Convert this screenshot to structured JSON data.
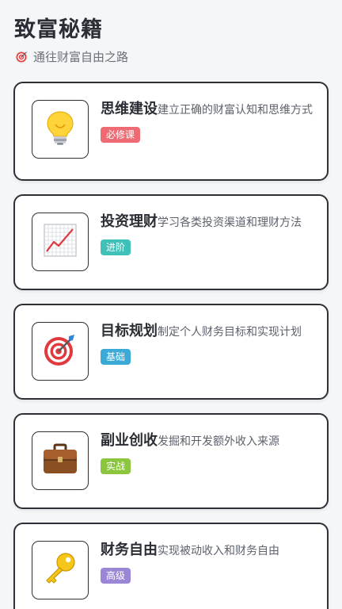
{
  "header": {
    "title": "致富秘籍",
    "subtitle": "通往财富自由之路",
    "subtitle_icon": "target-icon"
  },
  "cards": [
    {
      "title": "思维建设",
      "desc": "建立正确的财富认知和思维方式",
      "tag": "必修课",
      "tag_color": "#ef6b73",
      "icon": "lightbulb-icon"
    },
    {
      "title": "投资理财",
      "desc": "学习各类投资渠道和理财方法",
      "tag": "进阶",
      "tag_color": "#3fc1b8",
      "icon": "chart-increasing-icon"
    },
    {
      "title": "目标规划",
      "desc": "制定个人财务目标和实现计划",
      "tag": "基础",
      "tag_color": "#3baad6",
      "icon": "target-icon"
    },
    {
      "title": "副业创收",
      "desc": "发掘和开发额外收入来源",
      "tag": "实战",
      "tag_color": "#8cc63f",
      "icon": "briefcase-icon"
    },
    {
      "title": "财务自由",
      "desc": "实现被动收入和财务自由",
      "tag": "高级",
      "tag_color": "#9b86d6",
      "icon": "key-icon"
    }
  ]
}
